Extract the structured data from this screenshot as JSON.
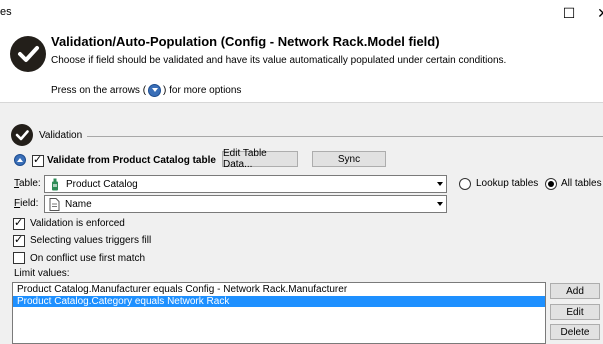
{
  "window": {
    "title_fragment": "es",
    "maximize_symbol": "☐",
    "close_symbol": "✕"
  },
  "header": {
    "title": "Validation/Auto-Population (Config - Network Rack.Model field)",
    "description": "Choose if field should be validated and have its value automatically populated under certain conditions.",
    "press_before": "Press on the arrows (",
    "press_after": ") for more options"
  },
  "section": {
    "label": "Validation"
  },
  "validate": {
    "label": "Validate from Product Catalog table",
    "checked": true,
    "edit_button": "Edit Table Data...",
    "sync_button": "Sync"
  },
  "table_field": {
    "label_prefix": "T",
    "label_rest": "able:",
    "value": "Product Catalog",
    "icon": "bottle-icon"
  },
  "field_field": {
    "label_prefix": "F",
    "label_rest": "ield:",
    "value": "Name",
    "icon": "document-icon"
  },
  "radios": {
    "lookup": "Lookup tables",
    "all": "All tables",
    "selected": "all"
  },
  "options": [
    {
      "label": "Validation is enforced",
      "checked": true
    },
    {
      "label": "Selecting values triggers fill",
      "checked": true
    },
    {
      "label": "On conflict use first match",
      "checked": false
    }
  ],
  "limit": {
    "label": "Limit values:",
    "rows": [
      {
        "text": "Product Catalog.Manufacturer equals Config - Network Rack.Manufacturer",
        "selected": false
      },
      {
        "text": "Product Catalog.Category equals Network Rack",
        "selected": true
      }
    ],
    "add_button": "Add",
    "edit_button": "Edit",
    "delete_button": "Delete"
  },
  "colors": {
    "selection": "#1e90ff",
    "icon_dark": "#231f1a",
    "arrow_blue": "#3a6fb8"
  }
}
